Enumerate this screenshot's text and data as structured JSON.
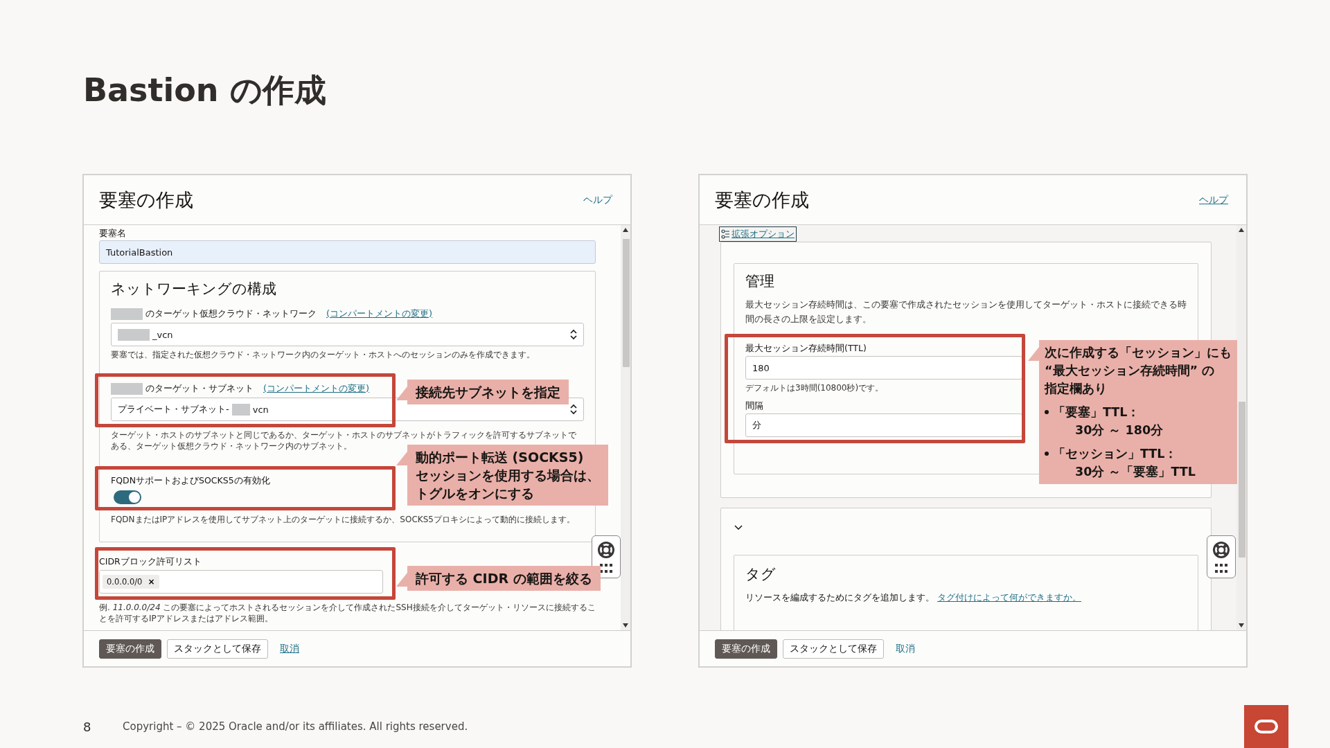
{
  "slide": {
    "title": "Bastion の作成",
    "page_number": "8",
    "copyright": "Copyright – © 2025 Oracle and/or its affiliates. All rights reserved."
  },
  "panels": [
    {
      "kind": "network",
      "title": "要塞の作成",
      "help_link": "ヘルプ",
      "name_label": "要塞名",
      "name_value": "TutorialBastion",
      "networking": {
        "title": "ネットワーキングの構成",
        "vcn_label": "のターゲット仮想クラウド・ネットワーク",
        "vcn_link": "(コンパートメントの変更)",
        "vcn_value": "_vcn",
        "vcn_help": "要塞では、指定された仮想クラウド・ネットワーク内のターゲット・ホストへのセッションのみを作成できます。",
        "subnet_label": "のターゲット・サブネット",
        "subnet_link": "(コンパートメントの変更)",
        "subnet_value_prefix": "プライベート・サブネット-",
        "subnet_value_suffix": "vcn",
        "subnet_help": "ターゲット・ホストのサブネットと同じであるか、ターゲット・ホストのサブネットがトラフィックを許可するサブネットである、ターゲット仮想クラウド・ネットワーク内のサブネット。",
        "fqdn_label": "FQDNサポートおよびSOCKS5の有効化",
        "fqdn_on": true,
        "fqdn_help": "FQDNまたはIPアドレスを使用してサブネット上のターゲットに接続するか、SOCKS5プロキシによって動的に接続します。"
      },
      "cidr_label": "CIDRブロック許可リスト",
      "cidr_chips": [
        {
          "label": "0.0.0.0/0",
          "remove": "×"
        }
      ],
      "cidr_help": "例. *11.0.0.0/24* この要塞によってホストされるセッションを介して作成されたSSH接続を介してターゲット・リソースに接続することを許可するIPアドレスまたはアドレス範囲。",
      "buttons": [
        {
          "label": "要塞の作成",
          "kind": "primary"
        },
        {
          "label": "スタックとして保存",
          "kind": "secondary"
        },
        {
          "label": "取消",
          "kind": "link"
        }
      ],
      "callouts": [
        {
          "lines": [
            "接続先サブネットを指定"
          ]
        },
        {
          "lines": [
            "動的ポート転送 (SOCKS5)",
            "セッションを使用する場合は、",
            "トグルをオンにする"
          ]
        },
        {
          "lines": [
            "許可する CIDR の範囲を絞る"
          ]
        }
      ]
    },
    {
      "kind": "options",
      "title": "要塞の作成",
      "help_link": "ヘルプ",
      "advanced_link": "拡張オプション",
      "management": {
        "title": "管理",
        "description": "最大セッション存続時間は、この要塞で作成されたセッションを使用してターゲット・ホストに接続できる時間の長さの上限を設定します。",
        "ttl_label": "最大セッション存続時間(TTL)",
        "ttl_value": "180",
        "ttl_help": "デフォルトは3時間(10800秒)です。",
        "interval_label": "間隔",
        "interval_value": "分"
      },
      "tags": {
        "title": "タグ",
        "description": "リソースを編成するためにタグを追加します。",
        "link": "タグ付けによって何ができますか。"
      },
      "buttons": [
        {
          "label": "要塞の作成",
          "kind": "primary"
        },
        {
          "label": "スタックとして保存",
          "kind": "secondary"
        },
        {
          "label": "取消",
          "kind": "link"
        }
      ],
      "callouts": [
        {
          "lines": [
            "次に作成する「セッション」にも",
            "“最大セッション存続時間” の",
            "指定欄あり"
          ],
          "bullets": [
            {
              "label": "「要塞」TTL：",
              "value": "30分 ～ 180分"
            },
            {
              "label": "「セッション」TTL：",
              "value": "30分 ～「要塞」TTL"
            }
          ]
        }
      ]
    }
  ]
}
